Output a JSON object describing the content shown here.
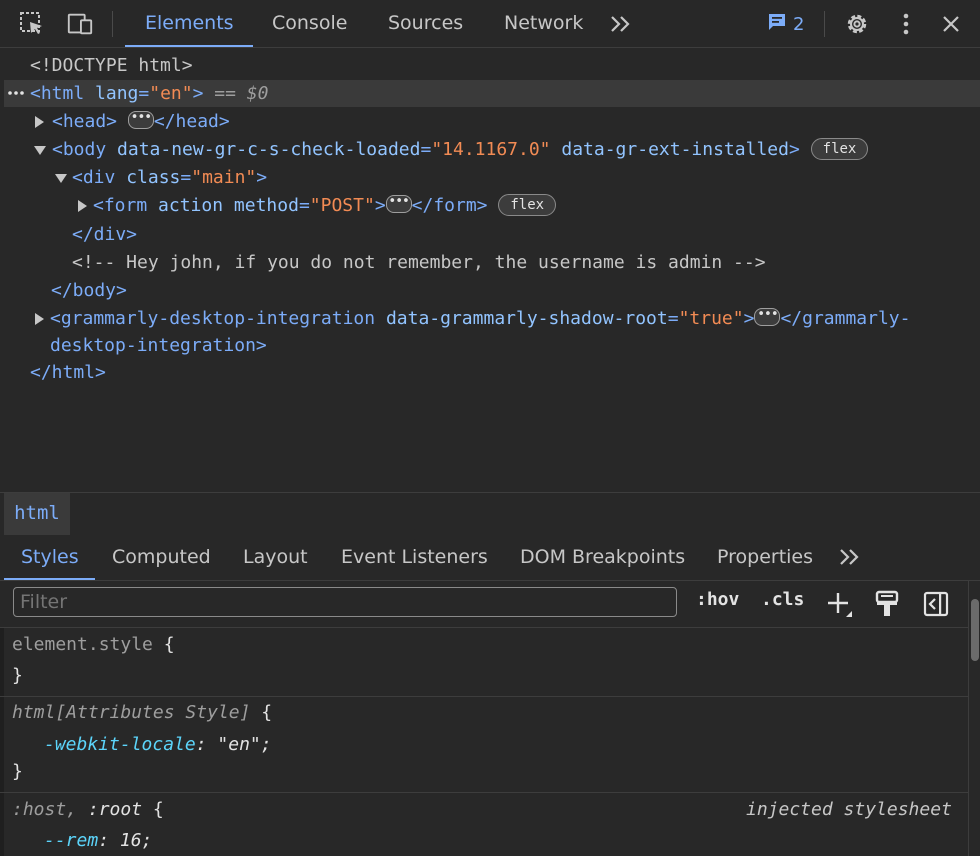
{
  "toolbar": {
    "tabs": [
      "Elements",
      "Console",
      "Sources",
      "Network"
    ],
    "active_tab": "Elements",
    "more_tabs": ">>",
    "issues_count": "2"
  },
  "tree": {
    "doctype": "<!DOCTYPE html>",
    "html_open": "<html",
    "html_lang_attr": "lang",
    "html_lang_val": "\"en\"",
    "html_close_bracket": ">",
    "selected_marker": "== $0",
    "head_open": "<head>",
    "head_close": "</head>",
    "body_open": "<body",
    "body_attr1": "data-new-gr-c-s-check-loaded",
    "body_attr1_val": "\"14.1167.0\"",
    "body_attr2": "data-gr-ext-installed",
    "body_close_bracket": ">",
    "flex_badge": "flex",
    "div_open": "<div",
    "div_attr": "class",
    "div_val": "\"main\"",
    "div_close_bracket": ">",
    "form_open": "<form",
    "form_attr1": "action",
    "form_attr2": "method",
    "form_val2": "\"POST\"",
    "form_close_bracket": ">",
    "form_close": "</form>",
    "div_close": "</div>",
    "comment": "<!-- Hey john, if you do not remember, the username is admin -->",
    "body_close": "</body>",
    "gram_open": "<grammarly-desktop-integration",
    "gram_attr": "data-grammarly-shadow-root",
    "gram_val": "\"true\"",
    "gram_close_bracket": ">",
    "gram_close_1": "</grammarly-",
    "gram_close_2": "desktop-integration>",
    "html_close": "</html>",
    "equals": "="
  },
  "breadcrumb": {
    "item": "html"
  },
  "styles_tabs": {
    "tabs": [
      "Styles",
      "Computed",
      "Layout",
      "Event Listeners",
      "DOM Breakpoints",
      "Properties"
    ],
    "active": "Styles",
    "more": ">>"
  },
  "filter": {
    "placeholder": "Filter",
    "hov": ":hov",
    "cls": ".cls"
  },
  "rules": {
    "r1_selector": "element.style",
    "open_brace": "{",
    "close_brace": "}",
    "r2_selector": "html[Attributes Style]",
    "r2_prop": "-webkit-locale",
    "r2_val": "\"en\";",
    "r3_selector_dim": ":host,",
    "r3_selector": ":root",
    "r3_source": "injected stylesheet",
    "r3_prop": "--rem",
    "r3_val": "16;",
    "colon": ":"
  }
}
